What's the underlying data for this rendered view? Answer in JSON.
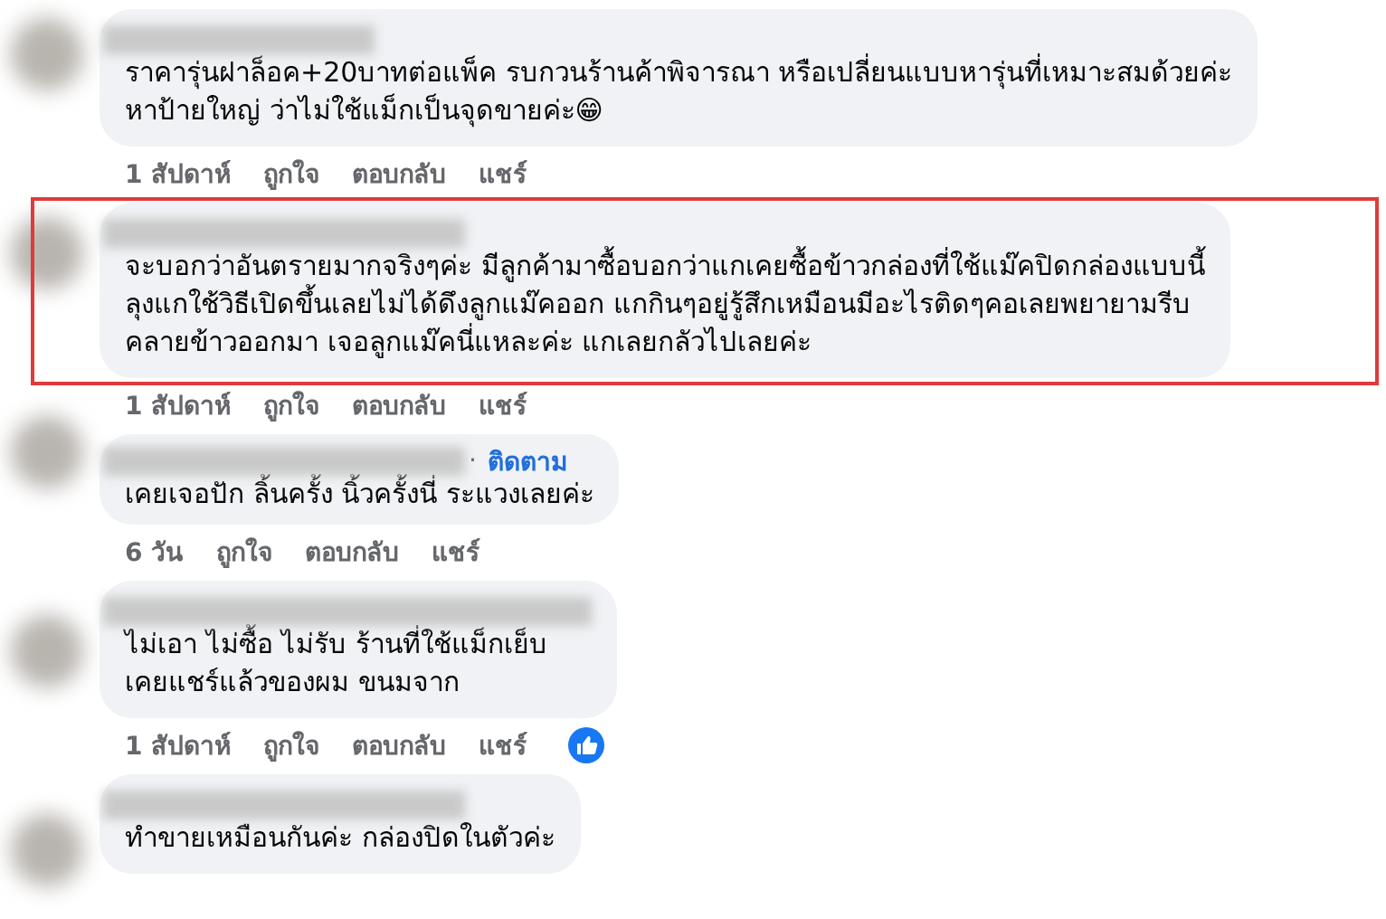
{
  "comments": [
    {
      "text": "ราคารุ่นฝาล็อค+20บาทต่อแพ็ค รบกวนร้านค้าพิจารณา หรือเปลี่ยนแบบหารุ่นที่เหมาะสมด้วยค่ะ\nหาป้ายใหญ่ ว่าไม่ใช้แม็กเป็นจุดขายค่ะ😁",
      "actions": [
        "1 สัปดาห์",
        "ถูกใจ",
        "ตอบกลับ",
        "แชร์"
      ],
      "highlighted": false,
      "reaction": false
    },
    {
      "text": "จะบอกว่าอันตรายมากจริงๆค่ะ มีลูกค้ามาซื้อบอกว่าแกเคยซื้อข้าวกล่องที่ใช้แม๊คปิดกล่องแบบนี้\nลุงแกใช้วิธีเปิดขึ้นเลยไม่ได้ดึงลูกแม๊คออก แกกินๆอยู่รู้สึกเหมือนมีอะไรติดๆคอเลยพยายามรีบ\nคลายข้าวออกมา เจอลูกแม๊คนี่แหละค่ะ แกเลยกลัวไปเลยค่ะ",
      "actions": [
        "1 สัปดาห์",
        "ถูกใจ",
        "ตอบกลับ",
        "แชร์"
      ],
      "highlighted": true,
      "reaction": false
    },
    {
      "name_separator": "·",
      "follow_link": "ติดตาม",
      "text": "เคยเจอปัก ลิ้นครั้ง นิ้วครั้งนี่ ระแวงเลยค่ะ",
      "actions": [
        "6 วัน",
        "ถูกใจ",
        "ตอบกลับ",
        "แชร์"
      ],
      "highlighted": false,
      "reaction": false
    },
    {
      "text": "ไม่เอา ไม่ซื้อ ไม่รับ ร้านที่ใช้แม็กเย็บ\nเคยแชร์แล้วของผม ขนมจาก",
      "actions": [
        "1 สัปดาห์",
        "ถูกใจ",
        "ตอบกลับ",
        "แชร์"
      ],
      "highlighted": false,
      "reaction": true
    },
    {
      "text": "ทำขายเหมือนกันค่ะ กล่องปิดในตัวค่ะ",
      "highlighted": false,
      "reaction": false
    }
  ]
}
